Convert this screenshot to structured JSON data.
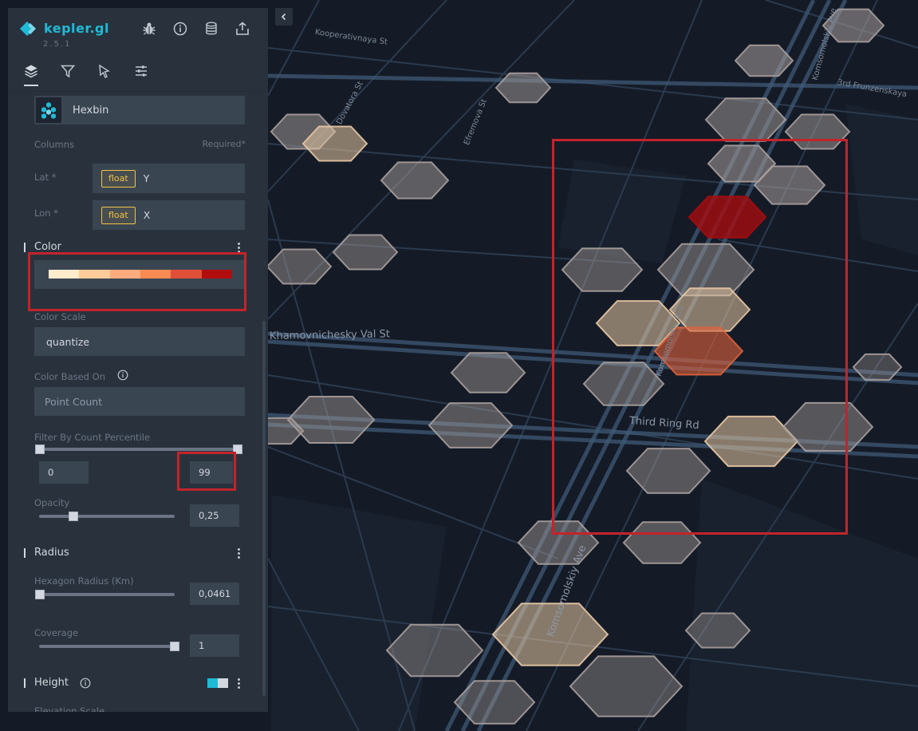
{
  "app": {
    "title": "kepler.gl",
    "version": "2.5.1"
  },
  "header_icons": [
    "bug-icon",
    "info-icon",
    "database-icon",
    "share-icon"
  ],
  "tabs": [
    {
      "name": "layers",
      "icon": "layers-icon",
      "active": true
    },
    {
      "name": "filters",
      "icon": "filter-icon",
      "active": false
    },
    {
      "name": "interactions",
      "icon": "cursor-icon",
      "active": false
    },
    {
      "name": "base-map",
      "icon": "settings-icon",
      "active": false
    }
  ],
  "layer": {
    "type_label": "Hexbin",
    "columns_label": "Columns",
    "required_label": "Required*",
    "lat": {
      "label": "Lat *",
      "type": "float",
      "value": "Y"
    },
    "lon": {
      "label": "Lon *",
      "type": "float",
      "value": "X"
    }
  },
  "color": {
    "section_title": "Color",
    "palette": [
      "#ffeccc",
      "#ffcc99",
      "#fcab7c",
      "#f88a54",
      "#e04f37",
      "#b20d0d"
    ],
    "scale_label": "Color Scale",
    "scale_value": "quantize",
    "based_on_label": "Color Based On",
    "based_on_placeholder": "Point Count",
    "percentile_label": "Filter By Count Percentile",
    "percentile_min": "0",
    "percentile_max": "99",
    "opacity_label": "Opacity",
    "opacity_value": "0,25",
    "opacity_fraction": 0.25
  },
  "radius": {
    "section_title": "Radius",
    "hex_radius_label": "Hexagon Radius (Km)",
    "hex_radius_value": "0,0461",
    "coverage_label": "Coverage",
    "coverage_value": "1"
  },
  "height": {
    "section_title": "Height",
    "enabled": true,
    "elevation_scale_label": "Elevation Scale"
  },
  "map": {
    "streets": [
      "Kooperativnaya St",
      "Dovatora St",
      "Efremova St",
      "Komsomolskiy Ave",
      "3rd Frunzenskaya",
      "Khamovnichesky Val St",
      "Third Ring Rd",
      "Komsomolskiy Ave",
      "Komsomolskiy Ave"
    ],
    "colors": {
      "background": "#141b27",
      "road": "#2b3a4d",
      "major_road": "#3f5975",
      "hex_neutral": "#a89f9c",
      "hex_light": "#e8c8a4",
      "hex_mid": "#f4ad7b",
      "hex_orange": "#e0633c",
      "hex_red": "#a40c10",
      "highlight": "#c2242b"
    }
  }
}
